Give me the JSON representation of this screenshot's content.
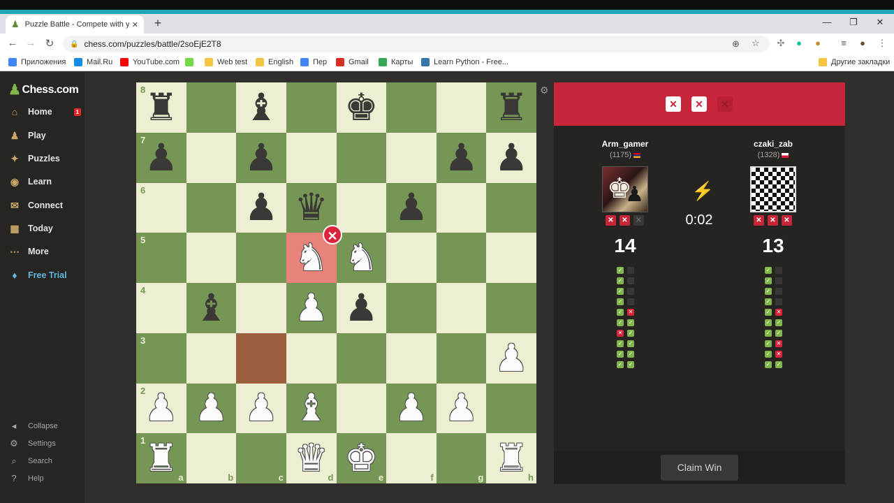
{
  "browser": {
    "tab_title": "Puzzle Battle - Compete with you",
    "url": "chess.com/puzzles/battle/2soEjE2T8",
    "bookmarks": [
      {
        "label": "Приложения",
        "icon": "apps-icon",
        "color": "#4285f4"
      },
      {
        "label": "Mail.Ru",
        "icon": "mailru-icon",
        "color": "#168de2"
      },
      {
        "label": "YouTube.com",
        "icon": "youtube-icon",
        "color": "#ff0000"
      },
      {
        "label": "",
        "icon": "upwork-icon",
        "color": "#6fda44"
      },
      {
        "label": "Web test",
        "icon": "folder-icon",
        "color": "#f4c542"
      },
      {
        "label": "English",
        "icon": "folder-icon",
        "color": "#f4c542"
      },
      {
        "label": "Пер",
        "icon": "translate-icon",
        "color": "#4285f4"
      },
      {
        "label": "Gmail",
        "icon": "gmail-icon",
        "color": "#d93025"
      },
      {
        "label": "Карты",
        "icon": "maps-icon",
        "color": "#34a853"
      },
      {
        "label": "Learn Python - Free...",
        "icon": "python-icon",
        "color": "#3776ab"
      }
    ],
    "other_bookmarks": "Другие закладки"
  },
  "sidebar": {
    "logo": "Chess.com",
    "items": [
      {
        "label": "Home",
        "icon": "home-icon",
        "badge": "1"
      },
      {
        "label": "Play",
        "icon": "play-icon"
      },
      {
        "label": "Puzzles",
        "icon": "puzzle-icon"
      },
      {
        "label": "Learn",
        "icon": "learn-icon"
      },
      {
        "label": "Connect",
        "icon": "connect-icon"
      },
      {
        "label": "Today",
        "icon": "today-icon"
      },
      {
        "label": "More",
        "icon": "more-icon"
      },
      {
        "label": "Free Trial",
        "icon": "diamond-icon"
      }
    ],
    "bottom": [
      {
        "label": "Collapse",
        "icon": "collapse-icon"
      },
      {
        "label": "Settings",
        "icon": "settings-icon"
      },
      {
        "label": "Search",
        "icon": "search-icon"
      },
      {
        "label": "Help",
        "icon": "help-icon"
      }
    ]
  },
  "board": {
    "files": [
      "a",
      "b",
      "c",
      "d",
      "e",
      "f",
      "g",
      "h"
    ],
    "ranks": [
      "8",
      "7",
      "6",
      "5",
      "4",
      "3",
      "2",
      "1"
    ],
    "position": [
      [
        "bR",
        "",
        "bB",
        "",
        "bK",
        "",
        "",
        "bR"
      ],
      [
        "bP",
        "",
        "bP",
        "",
        "",
        "",
        "bP",
        "bP"
      ],
      [
        "",
        "",
        "bP",
        "bQ",
        "",
        "bP",
        "",
        ""
      ],
      [
        "",
        "",
        "",
        "wN",
        "wN",
        "",
        "",
        ""
      ],
      [
        "",
        "bB",
        "",
        "wP",
        "bP",
        "",
        "",
        ""
      ],
      [
        "",
        "",
        "",
        "",
        "",
        "",
        "",
        "wP"
      ],
      [
        "wP",
        "wP",
        "wP",
        "wB",
        "",
        "wP",
        "wP",
        ""
      ],
      [
        "wR",
        "",
        "",
        "wQ",
        "wK",
        "",
        "",
        "wR"
      ]
    ],
    "highlight_square": "c3",
    "wrong_square": "d5",
    "colors": {
      "light": "#eeeed2",
      "dark": "#769656",
      "highlight": "#9b5f3f",
      "wrong": "#e8837a"
    }
  },
  "battle": {
    "header_strikes": [
      "on",
      "on",
      "off"
    ],
    "player1": {
      "name": "Arm_gamer",
      "rating": "(1175)",
      "strikes": [
        "on",
        "on",
        "off"
      ],
      "score": "14",
      "results": [
        [
          "ok",
          "none"
        ],
        [
          "ok",
          "none"
        ],
        [
          "ok",
          "none"
        ],
        [
          "ok",
          "none"
        ],
        [
          "ok",
          "bad"
        ],
        [
          "ok",
          "ok"
        ],
        [
          "bad",
          "ok"
        ],
        [
          "ok",
          "ok"
        ],
        [
          "ok",
          "ok"
        ],
        [
          "ok",
          "ok"
        ]
      ]
    },
    "player2": {
      "name": "czaki_zab",
      "rating": "(1328)",
      "strikes": [
        "on",
        "on",
        "on"
      ],
      "score": "13",
      "results": [
        [
          "ok",
          "none"
        ],
        [
          "ok",
          "none"
        ],
        [
          "ok",
          "none"
        ],
        [
          "ok",
          "none"
        ],
        [
          "ok",
          "bad"
        ],
        [
          "ok",
          "ok"
        ],
        [
          "ok",
          "ok"
        ],
        [
          "ok",
          "bad"
        ],
        [
          "ok",
          "bad"
        ],
        [
          "ok",
          "ok"
        ]
      ]
    },
    "timer": "0:02",
    "claim_label": "Claim Win"
  }
}
